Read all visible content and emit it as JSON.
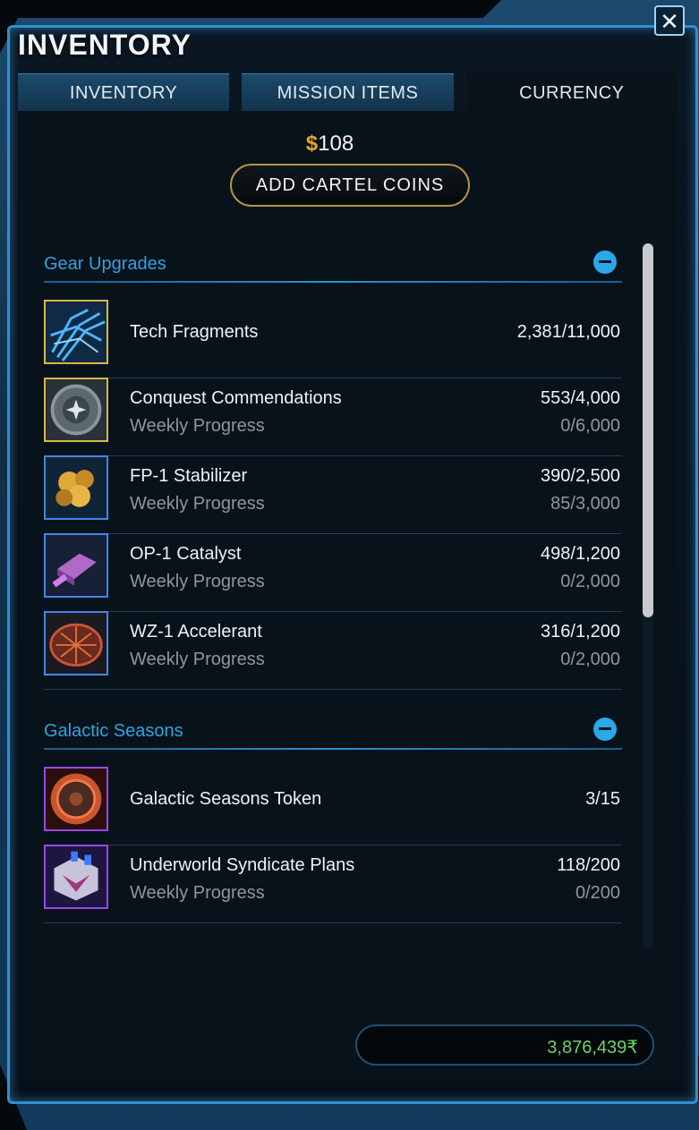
{
  "window": {
    "title": "INVENTORY",
    "close_glyph": "✕"
  },
  "tabs": [
    {
      "label": "INVENTORY",
      "active": false
    },
    {
      "label": "MISSION ITEMS",
      "active": false
    },
    {
      "label": "CURRENCY",
      "active": true
    }
  ],
  "cartel": {
    "coin_glyph": "$",
    "amount": "108",
    "add_button_label": "ADD CARTEL COINS"
  },
  "sections": [
    {
      "title": "Gear Upgrades",
      "rows": [
        {
          "name": "Tech Fragments",
          "value": "2,381/11,000",
          "icon": "tech-fragments-icon",
          "rarity": "gold"
        },
        {
          "name": "Conquest Commendations",
          "value": "553/4,000",
          "sub_label": "Weekly Progress",
          "sub_value": "0/6,000",
          "icon": "conquest-commendations-icon",
          "rarity": "gold"
        },
        {
          "name": "FP-1 Stabilizer",
          "value": "390/2,500",
          "sub_label": "Weekly Progress",
          "sub_value": "85/3,000",
          "icon": "stabilizer-icon",
          "rarity": "blue"
        },
        {
          "name": "OP-1 Catalyst",
          "value": "498/1,200",
          "sub_label": "Weekly Progress",
          "sub_value": "0/2,000",
          "icon": "catalyst-icon",
          "rarity": "blue"
        },
        {
          "name": "WZ-1 Accelerant",
          "value": "316/1,200",
          "sub_label": "Weekly Progress",
          "sub_value": "0/2,000",
          "icon": "accelerant-icon",
          "rarity": "blue"
        }
      ]
    },
    {
      "title": "Galactic Seasons",
      "rows": [
        {
          "name": "Galactic Seasons Token",
          "value": "3/15",
          "icon": "seasons-token-icon",
          "rarity": "purple"
        },
        {
          "name": "Underworld Syndicate Plans",
          "value": "118/200",
          "sub_label": "Weekly Progress",
          "sub_value": "0/200",
          "icon": "syndicate-plans-icon",
          "rarity": "purple"
        }
      ]
    }
  ],
  "credits": {
    "amount": "3,876,439",
    "credit_glyph": "₹"
  },
  "colors": {
    "accent_blue": "#2fa4e0",
    "gold_border": "#d9b646",
    "blue_border": "#3f88e8",
    "purple_border": "#9b48e6",
    "credits_green": "#6bd36b",
    "cartel_coin": "#e8a526"
  }
}
